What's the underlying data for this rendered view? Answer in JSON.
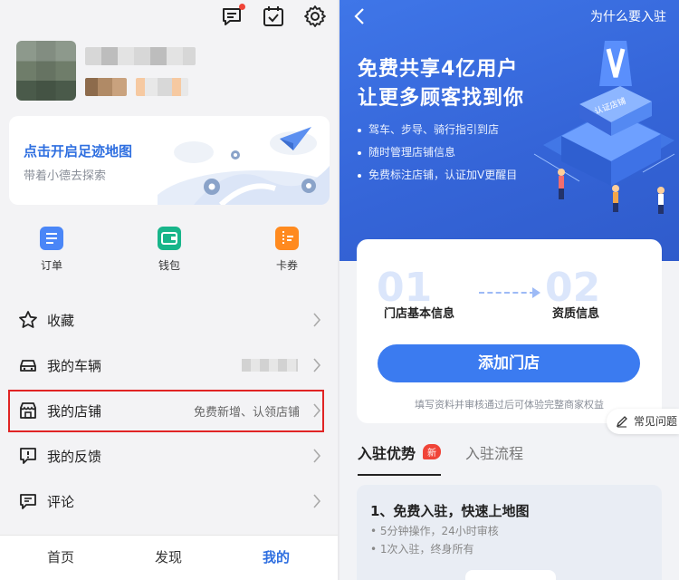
{
  "left": {
    "nav": {
      "home": "首页",
      "discover": "发现",
      "mine": "我的"
    },
    "map_card": {
      "title": "点击开启足迹地图",
      "subtitle": "带着小德去探索"
    },
    "quick": [
      {
        "label": "订单",
        "icon": "order-icon",
        "color": "#4a86f7"
      },
      {
        "label": "钱包",
        "icon": "wallet-icon",
        "color": "#18b58a"
      },
      {
        "label": "卡券",
        "icon": "coupon-icon",
        "color": "#ff8a1f"
      }
    ],
    "menu": [
      {
        "label": "收藏",
        "icon": "star-icon"
      },
      {
        "label": "我的车辆",
        "icon": "car-icon"
      },
      {
        "label": "我的店铺",
        "icon": "store-icon",
        "value": "免费新增、认领店铺"
      },
      {
        "label": "我的反馈",
        "icon": "feedback-icon"
      },
      {
        "label": "评论",
        "icon": "comment-icon"
      }
    ]
  },
  "right": {
    "header": {
      "why": "为什么要入驻"
    },
    "hero": {
      "line1": "免费共享4亿用户",
      "line2": "让更多顾客找到你",
      "bullets": [
        "驾车、步导、骑行指引到店",
        "随时管理店铺信息",
        "免费标注店铺，认证加V更醒目"
      ],
      "building_sign": "认证店铺"
    },
    "steps": [
      {
        "num": "01",
        "label": "门店基本信息"
      },
      {
        "num": "02",
        "label": "资质信息"
      }
    ],
    "add_button": "添加门店",
    "note": "填写资料并审核通过后可体验完整商家权益",
    "faq": "常见问题",
    "tabs": {
      "advantages": "入驻优势",
      "new_badge": "新",
      "process": "入驻流程"
    },
    "benefit": {
      "title": "1、免费入驻，快速上地图",
      "items": [
        "5分钟操作，24小时审核",
        "1次入驻，终身所有"
      ]
    }
  },
  "colors": {
    "accent": "#2f6fe0",
    "button": "#3b7bf0",
    "highlight": "#e02424",
    "hero": "#3565d8"
  }
}
